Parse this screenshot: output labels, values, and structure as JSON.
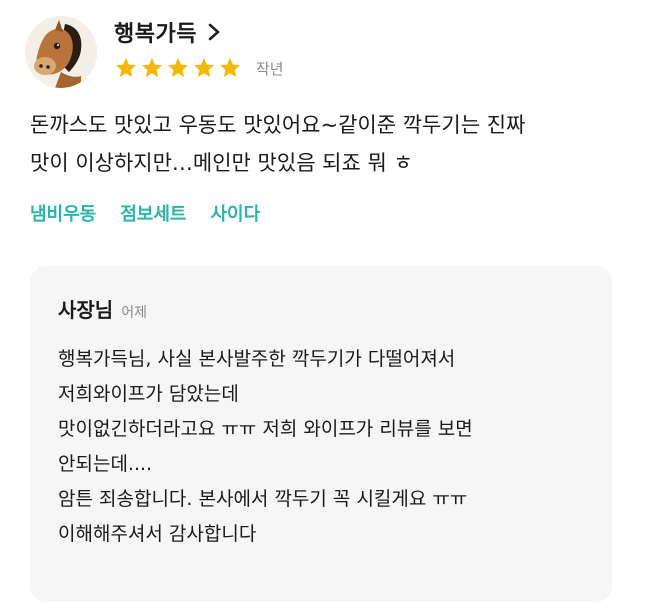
{
  "review": {
    "user_name": "행복가득",
    "rating": 5,
    "date": "작년",
    "text_lines": [
      "돈까스도 맛있고 우동도 맛있어요~같이준 깍두기는 진짜",
      "맛이 이상하지만…메인만 맛있음 되죠 뭐 ㅎ"
    ],
    "menu_tags": [
      "냄비우동",
      "점보세트",
      "사이다"
    ]
  },
  "reply": {
    "owner_label": "사장님",
    "date": "어제",
    "text_lines": [
      "행복가득님, 사실 본사발주한 깍두기가 다떨어져서",
      "저희와이프가 담았는데",
      "맛이없긴하더라고요 ㅠㅠ 저희 와이프가 리뷰를 보면",
      "안되는데....",
      "암튼 죄송합니다. 본사에서 깍두기 꼭 시킬게요 ㅠㅠ",
      "이해해주셔서 감사합니다"
    ]
  },
  "colors": {
    "star": "#f5b700",
    "menu_tag": "#2bb5a8",
    "reply_bg": "#f6f6f6"
  },
  "icons": {
    "avatar": "horse-avatar-icon",
    "chevron": "chevron-right-icon",
    "star": "star-icon"
  }
}
